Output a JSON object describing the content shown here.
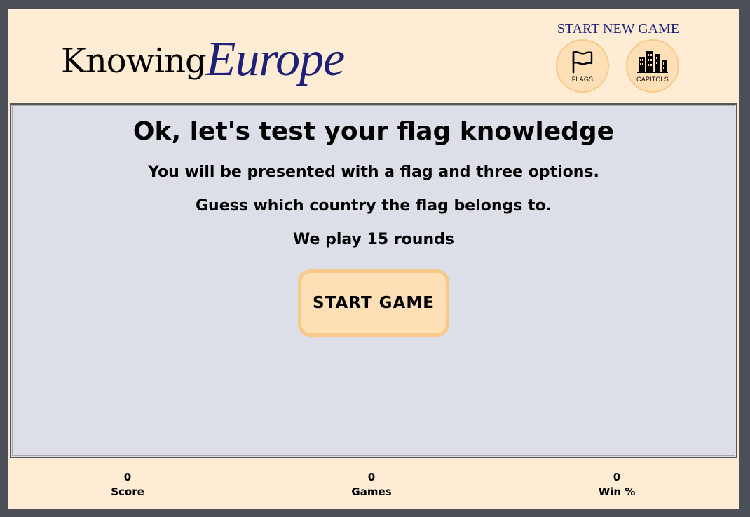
{
  "header": {
    "logo_part1": "Knowing",
    "logo_part2": "Europe",
    "new_game_title": "START NEW GAME",
    "modes": [
      {
        "label": "FLAGS",
        "icon": "flag-icon"
      },
      {
        "label": "CAPITOLS",
        "icon": "city-buildings-icon"
      }
    ]
  },
  "main": {
    "title": "Ok, let's test your flag knowledge",
    "instructions": [
      "You will be presented with a flag and three options.",
      "Guess which country the flag belongs to.",
      "We play 15 rounds"
    ],
    "start_button_label": "START GAME"
  },
  "footer": {
    "stats": [
      {
        "value": "0",
        "label": "Score"
      },
      {
        "value": "0",
        "label": "Games"
      },
      {
        "value": "0",
        "label": "Win %"
      }
    ]
  },
  "colors": {
    "page_background": "#4b4f58",
    "header_background": "#ffecd5",
    "panel_background": "#dcdfe8",
    "button_fill": "#ffe0b6",
    "button_border": "#f9c98a",
    "brand_accent": "#1f2178"
  }
}
